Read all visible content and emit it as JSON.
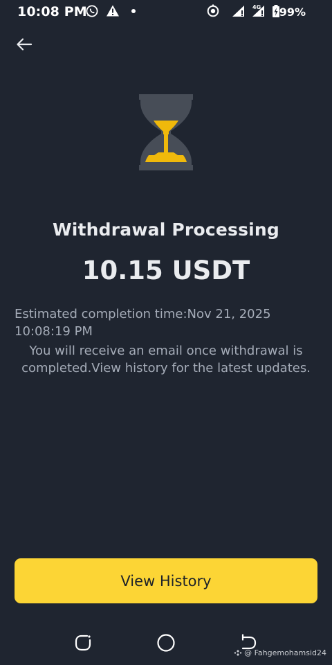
{
  "status_bar": {
    "time": "10:08 PM",
    "network_badge": "4G",
    "battery_percent": "99%",
    "icons": [
      "whatsapp-icon",
      "alert-icon",
      "dot-icon",
      "target-icon",
      "signal-icon",
      "signal-icon-2",
      "battery-icon"
    ]
  },
  "header": {
    "back_icon": "arrow-left-icon"
  },
  "main": {
    "status_icon": "hourglass-icon",
    "title": "Withdrawal Processing",
    "amount": "10.15 USDT",
    "estimate_text": "Estimated completion time:Nov 21, 2025 10:08:19 PM",
    "note_text": "You will receive an email once withdrawal is completed.View history for the latest updates."
  },
  "actions": {
    "view_history_label": "View History"
  },
  "nav_bar": {
    "icons": [
      "recents-icon",
      "home-icon",
      "back-icon"
    ]
  },
  "watermark": {
    "text": "@ Fahgemohamsid24"
  },
  "colors": {
    "background": "#1f2530",
    "accent": "#fcd535",
    "hourglass_frame": "#474d57",
    "text_primary": "#eaecef",
    "text_secondary": "#a5acb8"
  }
}
